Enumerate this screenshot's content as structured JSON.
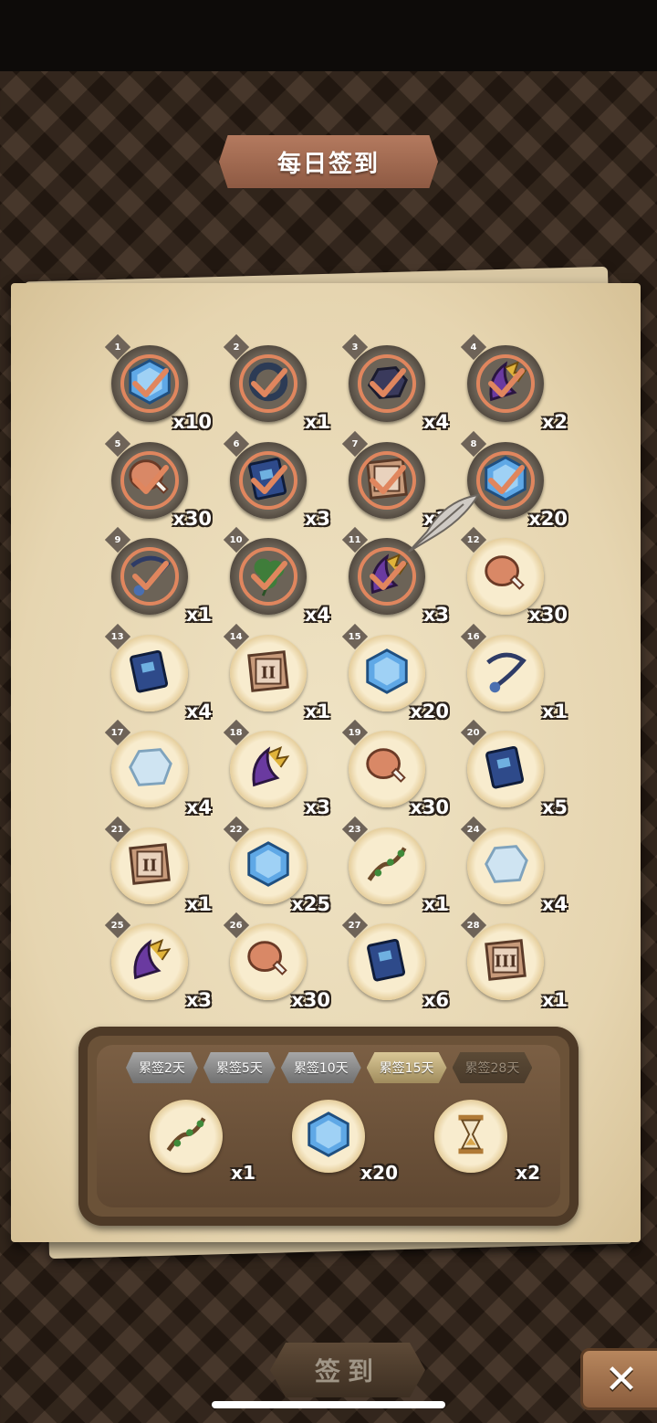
{
  "title": "每日签到",
  "days": [
    {
      "day": "1",
      "qty": "x10",
      "icon": "gem-icon",
      "claimed": true
    },
    {
      "day": "2",
      "qty": "x1",
      "icon": "ring-icon",
      "claimed": true
    },
    {
      "day": "3",
      "qty": "x4",
      "icon": "ore-icon",
      "claimed": true
    },
    {
      "day": "4",
      "qty": "x2",
      "icon": "claw-icon",
      "claimed": true
    },
    {
      "day": "5",
      "qty": "x30",
      "icon": "meat-icon",
      "claimed": true
    },
    {
      "day": "6",
      "qty": "x3",
      "icon": "book-icon",
      "claimed": true
    },
    {
      "day": "7",
      "qty": "x1",
      "icon": "scroll-icon",
      "claimed": true
    },
    {
      "day": "8",
      "qty": "x20",
      "icon": "gem-icon",
      "claimed": true
    },
    {
      "day": "9",
      "qty": "x1",
      "icon": "amulet-icon",
      "claimed": true
    },
    {
      "day": "10",
      "qty": "x4",
      "icon": "clover-icon",
      "claimed": true
    },
    {
      "day": "11",
      "qty": "x3",
      "icon": "claw-icon",
      "claimed": true
    },
    {
      "day": "12",
      "qty": "x30",
      "icon": "meat-icon",
      "claimed": false
    },
    {
      "day": "13",
      "qty": "x4",
      "icon": "book-icon",
      "claimed": false
    },
    {
      "day": "14",
      "qty": "x1",
      "icon": "scroll-ii-icon",
      "claimed": false
    },
    {
      "day": "15",
      "qty": "x20",
      "icon": "gem-icon",
      "claimed": false
    },
    {
      "day": "16",
      "qty": "x1",
      "icon": "amulet-icon",
      "claimed": false
    },
    {
      "day": "17",
      "qty": "x4",
      "icon": "ice-ore-icon",
      "claimed": false
    },
    {
      "day": "18",
      "qty": "x3",
      "icon": "claw-icon",
      "claimed": false
    },
    {
      "day": "19",
      "qty": "x30",
      "icon": "meat-icon",
      "claimed": false
    },
    {
      "day": "20",
      "qty": "x5",
      "icon": "book-icon",
      "claimed": false
    },
    {
      "day": "21",
      "qty": "x1",
      "icon": "scroll-ii-icon",
      "claimed": false
    },
    {
      "day": "22",
      "qty": "x25",
      "icon": "gem-icon",
      "claimed": false
    },
    {
      "day": "23",
      "qty": "x1",
      "icon": "vine-icon",
      "claimed": false
    },
    {
      "day": "24",
      "qty": "x4",
      "icon": "ice-ore-icon",
      "claimed": false
    },
    {
      "day": "25",
      "qty": "x3",
      "icon": "claw-icon",
      "claimed": false
    },
    {
      "day": "26",
      "qty": "x30",
      "icon": "meat-icon",
      "claimed": false
    },
    {
      "day": "27",
      "qty": "x6",
      "icon": "book-icon",
      "claimed": false
    },
    {
      "day": "28",
      "qty": "x1",
      "icon": "scroll-iii-icon",
      "claimed": false
    }
  ],
  "cumulative": {
    "tabs": [
      {
        "label": "累签2天",
        "state": "normal"
      },
      {
        "label": "累签5天",
        "state": "normal"
      },
      {
        "label": "累签10天",
        "state": "normal"
      },
      {
        "label": "累签15天",
        "state": "active"
      },
      {
        "label": "累签28天",
        "state": "disabled"
      }
    ],
    "rewards": [
      {
        "qty": "x1",
        "icon": "vine-icon"
      },
      {
        "qty": "x20",
        "icon": "gem-icon"
      },
      {
        "qty": "x2",
        "icon": "hourglass-icon"
      }
    ]
  },
  "sign_button": "签到",
  "close_button": "✕",
  "colors": {
    "check": "#e0865e",
    "gem": "#5fa8e6",
    "book": "#2e4a8a",
    "meat": "#d98866"
  }
}
